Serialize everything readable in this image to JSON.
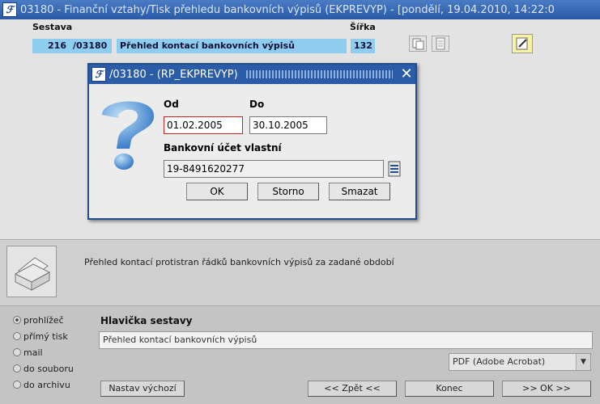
{
  "window": {
    "title": "03180 - Finanční vztahy/Tisk přehledu bankovních výpisů (EKPREVYP) - [pondělí, 19.04.2010, 14:22:0",
    "logo_text": "ℱ"
  },
  "report": {
    "sestava_header": "Sestava",
    "sirka_header": "Šířka",
    "number": "216",
    "code": "/03180",
    "name": "Přehled kontací bankovních výpisů",
    "width": "132"
  },
  "dialog": {
    "logo_text": "ℱ",
    "title": "/03180 - (RP_EKPREVYP)",
    "close_label": "✕",
    "od_label": "Od",
    "od_value": "01.02.2005",
    "do_label": "Do",
    "do_value": "30.10.2005",
    "account_label": "Bankovní účet vlastní",
    "account_value": "19-8491620277",
    "ok_label": "OK",
    "storno_label": "Storno",
    "smazat_label": "Smazat"
  },
  "info": {
    "description": "Přehled kontací protistran řádků bankovních výpisů za zadané období"
  },
  "output": {
    "options": [
      "prohlížeč",
      "přímý tisk",
      "mail",
      "do souboru",
      "do archivu"
    ],
    "selected": "prohlížeč",
    "header_label": "Hlavička sestavy",
    "header_value": "Přehled kontací bankovních výpisů",
    "format_value": "PDF (Adobe Acrobat)",
    "nastav_label": "Nastav výchozí",
    "back_label": "<< Zpět <<",
    "konec_label": "Konec",
    "ok_label": ">> OK >>"
  },
  "colors": {
    "title_bar": "#2b5ca8",
    "highlight": "#8ecdf0",
    "error_border": "#d02020",
    "yellow_button": "#f8f3a0"
  }
}
